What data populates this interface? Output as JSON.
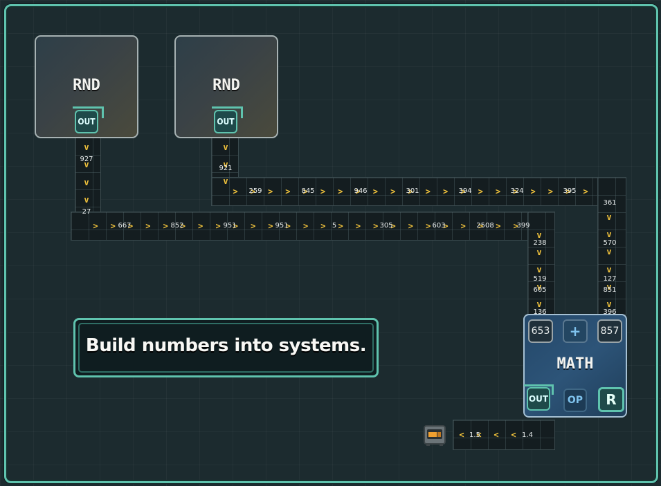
{
  "banner": {
    "text": "Build numbers into systems."
  },
  "nodes": {
    "rnd1": {
      "title": "RND",
      "out_label": "OUT"
    },
    "rnd2": {
      "title": "RND",
      "out_label": "OUT"
    }
  },
  "math": {
    "title": "MATH",
    "left_value": "653",
    "operator": "+",
    "right_value": "857",
    "out_label": "OUT",
    "op_label": "OP",
    "r_label": "R"
  },
  "belt_numbers": {
    "rnd1_down": [
      "927",
      "27"
    ],
    "rnd2_down": [
      "921"
    ],
    "upper_row": [
      "259",
      "845",
      "946",
      "301",
      "394",
      "324",
      "395"
    ],
    "lower_row": [
      "667",
      "852",
      "951",
      "951",
      "5",
      "305",
      "603",
      "2508",
      "399"
    ],
    "right_col": [
      "361",
      "570",
      "127",
      "851",
      "396"
    ],
    "mid_col": [
      "238",
      "519",
      "605",
      "136"
    ],
    "bottom_row": [
      "1.5",
      "1.4"
    ]
  },
  "icons": {
    "sink": "storage-crate-icon"
  },
  "colors": {
    "accent": "#5fc3ae",
    "arrow": "#f0c23c",
    "math_panel": "#2d5478"
  }
}
